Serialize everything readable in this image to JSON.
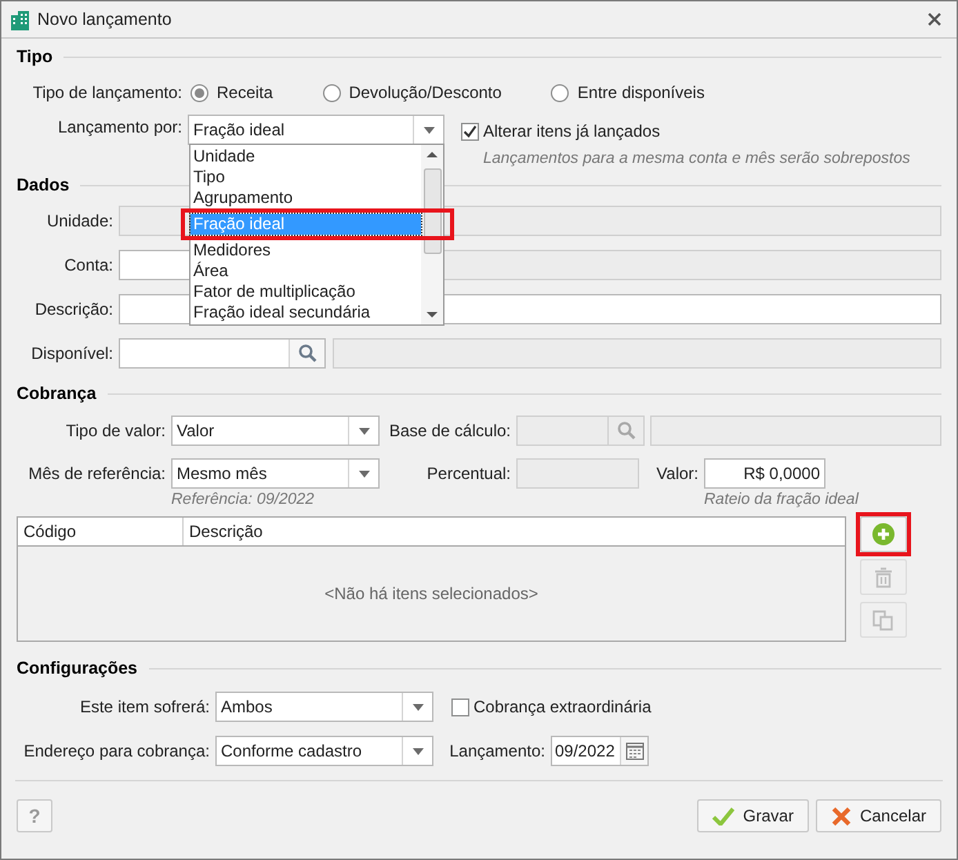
{
  "window": {
    "title": "Novo lançamento"
  },
  "tipo": {
    "heading": "Tipo",
    "tipo_label": "Tipo de lançamento:",
    "options": [
      {
        "label": "Receita",
        "selected": true
      },
      {
        "label": "Devolução/Desconto",
        "selected": false
      },
      {
        "label": "Entre disponíveis",
        "selected": false
      }
    ],
    "lancamento_label": "Lançamento por:",
    "lancamento_value": "Fração ideal",
    "dropdown": {
      "expanded": true,
      "items": [
        {
          "label": "Unidade",
          "selected": false,
          "annotated": false
        },
        {
          "label": "Tipo",
          "selected": false,
          "annotated": false
        },
        {
          "label": "Agrupamento",
          "selected": false,
          "annotated": false
        },
        {
          "label": "Fração ideal",
          "selected": true,
          "annotated": true
        },
        {
          "label": "Medidores",
          "selected": false,
          "annotated": false
        },
        {
          "label": "Área",
          "selected": false,
          "annotated": false
        },
        {
          "label": "Fator de multiplicação",
          "selected": false,
          "annotated": false
        },
        {
          "label": "Fração ideal secundária",
          "selected": false,
          "annotated": false
        }
      ]
    },
    "alterar": {
      "label": "Alterar itens já lançados",
      "checked": true
    },
    "hint": "Lançamentos para a mesma conta e mês serão sobrepostos"
  },
  "dados": {
    "heading": "Dados",
    "fields": [
      {
        "label": "Unidade:",
        "kind": "disabled"
      },
      {
        "label": "Conta:",
        "kind": "split"
      },
      {
        "label": "Descrição:",
        "kind": "text"
      },
      {
        "label": "Disponível:",
        "kind": "lookup"
      }
    ]
  },
  "cobranca": {
    "heading": "Cobrança",
    "tipo_valor_label": "Tipo de valor:",
    "tipo_valor": "Valor",
    "base_label": "Base de cálculo:",
    "mes_label": "Mês de referência:",
    "mes": "Mesmo mês",
    "percentual_label": "Percentual:",
    "valor_label": "Valor:",
    "valor": "R$ 0,0000",
    "referencia_hint": "Referência: 09/2022",
    "rateio_hint": "Rateio da fração ideal"
  },
  "table": {
    "columns": [
      "Código",
      "Descrição"
    ],
    "empty": "<Não há itens selecionados>"
  },
  "side_buttons": [
    {
      "kind": "add",
      "disabled": false,
      "annotated": true
    },
    {
      "kind": "delete",
      "disabled": true,
      "annotated": false
    },
    {
      "kind": "copy",
      "disabled": true,
      "annotated": false
    }
  ],
  "configuracoes": {
    "heading": "Configurações",
    "sofrera_label": "Este item sofrerá:",
    "sofrera": "Ambos",
    "extra": {
      "label": "Cobrança extraordinária",
      "checked": false
    },
    "endereco_label": "Endereço para cobrança:",
    "endereco": "Conforme cadastro",
    "lancamento_label": "Lançamento:",
    "lancamento": "09/2022"
  },
  "footer": {
    "help": "?",
    "buttons": [
      {
        "kind": "save",
        "label": "Gravar"
      },
      {
        "kind": "cancel",
        "label": "Cancelar"
      }
    ]
  }
}
